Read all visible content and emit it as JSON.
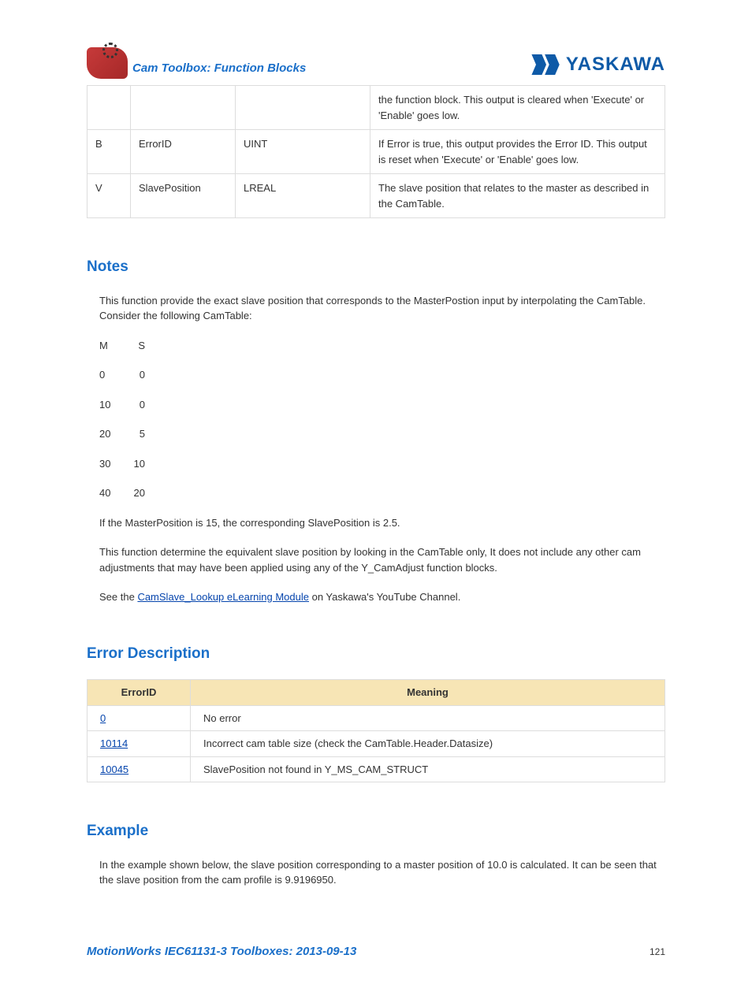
{
  "header": {
    "title": "Cam Toolbox: Function Blocks",
    "brand": "YASKAWA"
  },
  "paramsTable": {
    "rows": [
      {
        "c0": "",
        "c1": "",
        "c2": "",
        "c3": "the function block. This output is cleared when 'Execute' or 'Enable' goes low."
      },
      {
        "c0": "B",
        "c1": "ErrorID",
        "c2": "UINT",
        "c3": "If Error is true, this output provides the Error ID. This output is reset when 'Execute' or 'Enable' goes low."
      },
      {
        "c0": "V",
        "c1": "SlavePosition",
        "c2": "LREAL",
        "c3": "The slave position that relates to the master as described in the CamTable."
      }
    ]
  },
  "notes": {
    "heading": "Notes",
    "p1": "This function provide the exact slave position that corresponds to the MasterPostion input by interpolating the CamTable.  Consider the following CamTable:",
    "msHeader": {
      "m": "M",
      "s": "S"
    },
    "msRows": [
      {
        "m": "0",
        "s": "0"
      },
      {
        "m": "10",
        "s": "0"
      },
      {
        "m": "20",
        "s": "5"
      },
      {
        "m": "30",
        "s": "10"
      },
      {
        "m": "40",
        "s": "20"
      }
    ],
    "p2": "If the MasterPosition is 15, the corresponding SlavePosition is 2.5.",
    "p3": "This function determine the equivalent slave position by looking in the CamTable only, It does not include any other cam adjustments that may have been applied using any of the Y_CamAdjust function blocks.",
    "p4a": "See the ",
    "linkText": "CamSlave_Lookup eLearning Module",
    "p4b": " on Yaskawa's YouTube Channel."
  },
  "errorDesc": {
    "heading": "Error Description",
    "th1": "ErrorID",
    "th2": "Meaning",
    "rows": [
      {
        "id": "0",
        "meaning": "No error"
      },
      {
        "id": "10114",
        "meaning": "Incorrect cam table size (check the CamTable.Header.Datasize)"
      },
      {
        "id": "10045",
        "meaning": "SlavePosition not found in Y_MS_CAM_STRUCT"
      }
    ]
  },
  "example": {
    "heading": "Example",
    "p1": "In the example shown below, the slave position corresponding to a master position of 10.0 is calculated. It can be seen that the slave position from the cam profile is 9.9196950."
  },
  "footer": {
    "title": "MotionWorks IEC61131-3 Toolboxes: 2013-09-13",
    "page": "121"
  }
}
